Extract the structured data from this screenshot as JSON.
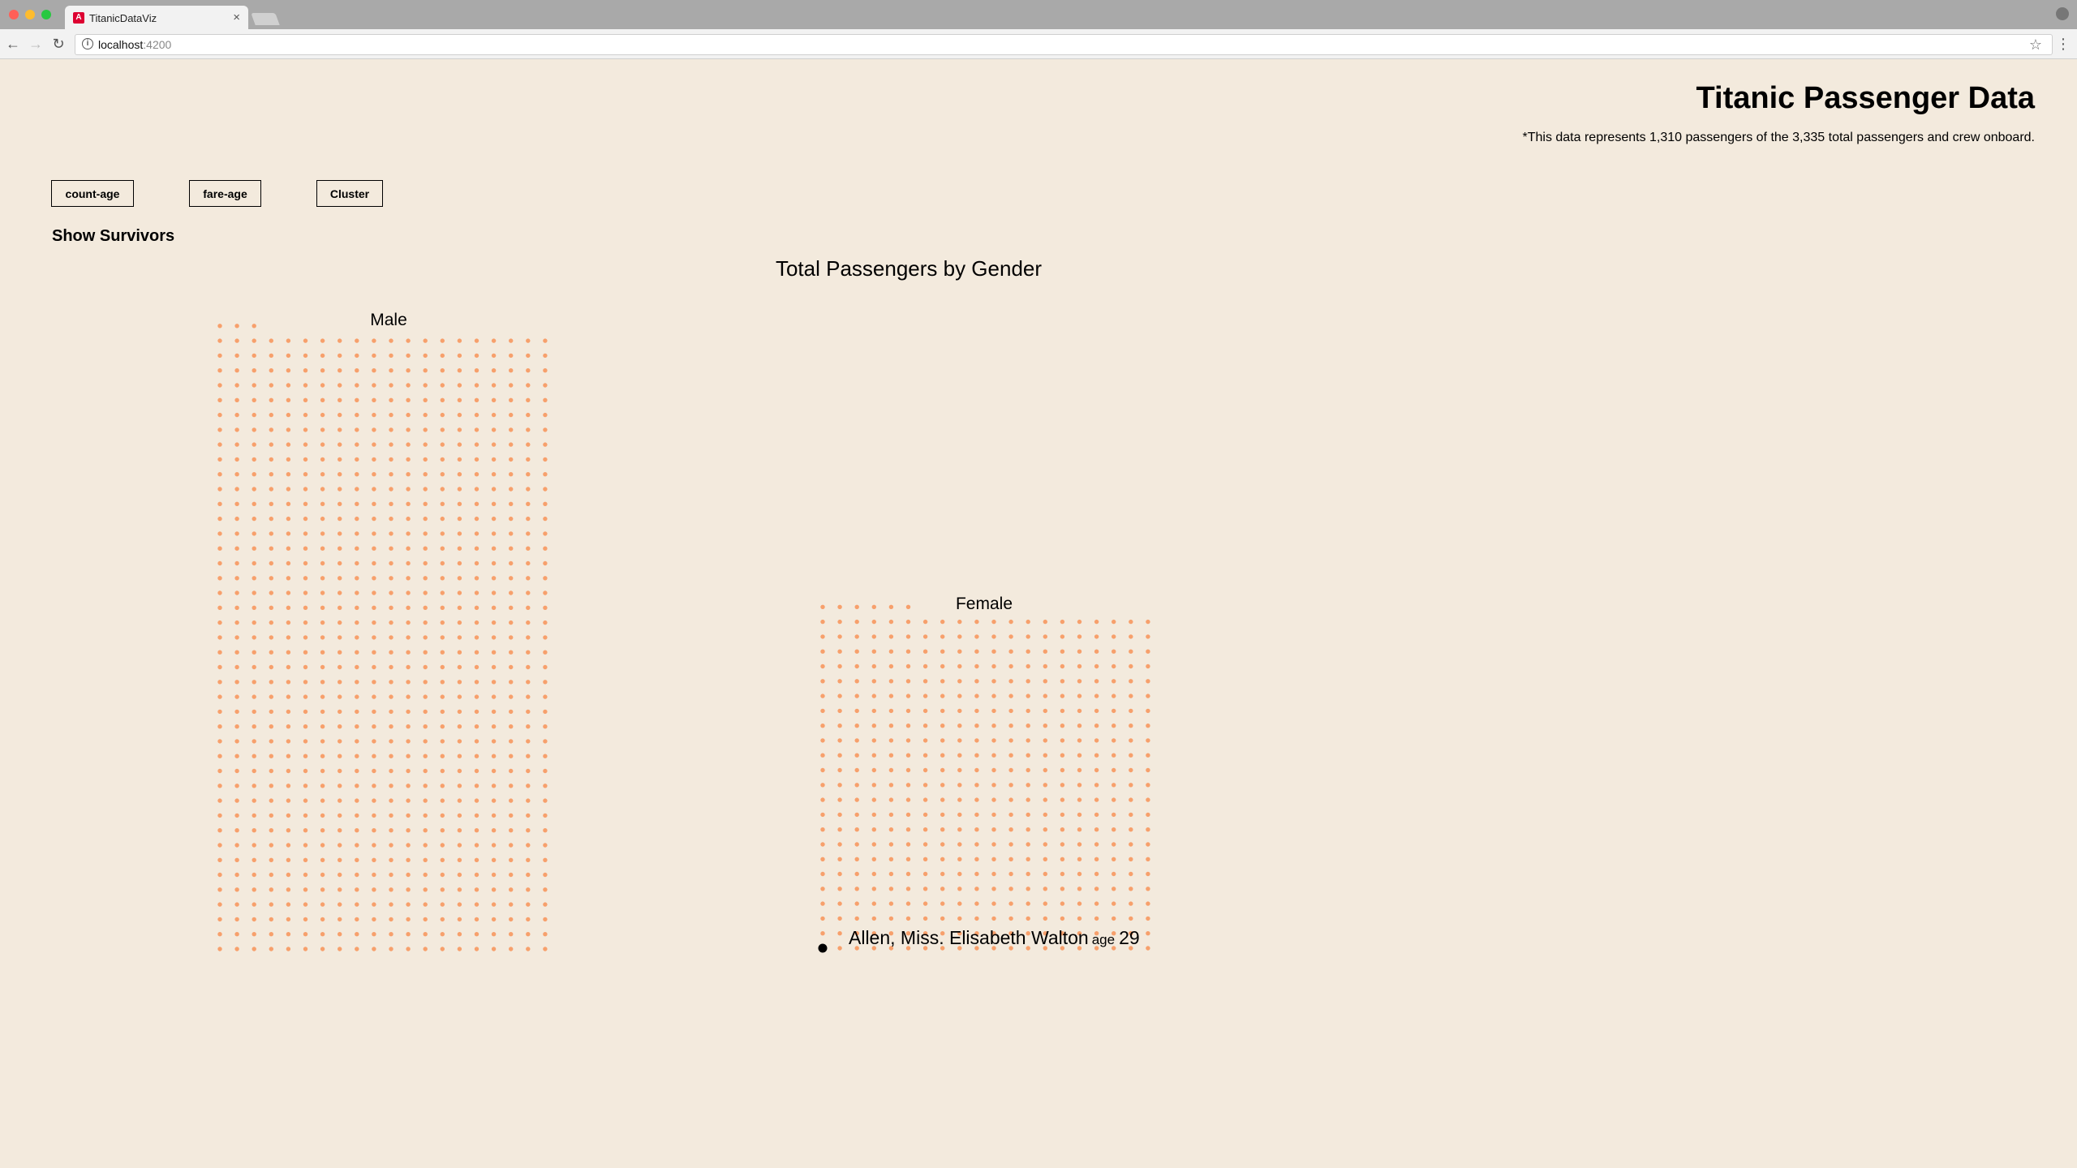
{
  "browser": {
    "tab_title": "TitanicDataViz",
    "url_host": "localhost",
    "url_port": ":4200"
  },
  "header": {
    "title": "Titanic Passenger Data",
    "subtitle": "*This data represents 1,310 passengers of the 3,335 total passengers and crew onboard."
  },
  "controls": {
    "buttons": [
      "count-age",
      "fare-age",
      "Cluster"
    ],
    "show_survivors": "Show Survivors"
  },
  "colors": {
    "dot": "#f7a06c",
    "highlight": "#000000",
    "background": "#f3eadd"
  },
  "chart_data": {
    "type": "scatter",
    "title": "Total Passengers by Gender",
    "groups": [
      {
        "name": "Male",
        "count": 843
      },
      {
        "name": "Female",
        "count": 466
      }
    ],
    "highlighted": {
      "group": "Female",
      "name": "Allen, Miss. Elisabeth Walton",
      "age_prefix": "age",
      "age": "29"
    }
  }
}
